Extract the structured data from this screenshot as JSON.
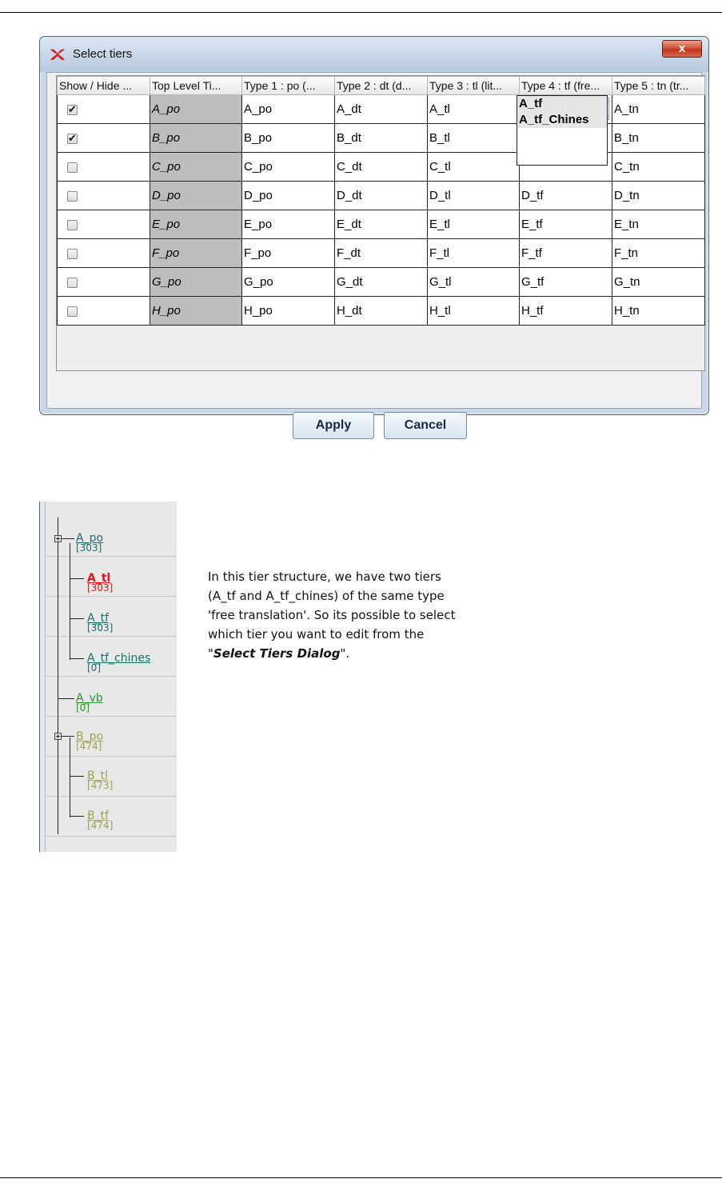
{
  "dialog": {
    "title": "Select tiers",
    "close_label": "x",
    "columns": [
      "Show / Hide ...",
      "Top Level Ti...",
      "Type 1 : po (...",
      "Type 2 : dt (d...",
      "Type 3 : tl (lit...",
      "Type 4 : tf (fre...",
      "Type 5 : tn (tr..."
    ],
    "rows": [
      {
        "checked": true,
        "top": "A_po",
        "t1": "A_po",
        "t2": "A_dt",
        "t3": "A_tl",
        "t4": "",
        "t5": "A_tn"
      },
      {
        "checked": true,
        "top": "B_po",
        "t1": "B_po",
        "t2": "B_dt",
        "t3": "B_tl",
        "t4": "",
        "t5": "B_tn"
      },
      {
        "checked": false,
        "top": "C_po",
        "t1": "C_po",
        "t2": "C_dt",
        "t3": "C_tl",
        "t4": "",
        "t5": "C_tn"
      },
      {
        "checked": false,
        "top": "D_po",
        "t1": "D_po",
        "t2": "D_dt",
        "t3": "D_tl",
        "t4": "D_tf",
        "t5": "D_tn"
      },
      {
        "checked": false,
        "top": "E_po",
        "t1": "E_po",
        "t2": "E_dt",
        "t3": "E_tl",
        "t4": "E_tf",
        "t5": "E_tn"
      },
      {
        "checked": false,
        "top": "F_po",
        "t1": "F_po",
        "t2": "F_dt",
        "t3": "F_tl",
        "t4": "F_tf",
        "t5": "F_tn"
      },
      {
        "checked": false,
        "top": "G_po",
        "t1": "G_po",
        "t2": "G_dt",
        "t3": "G_tl",
        "t4": "G_tf",
        "t5": "G_tn"
      },
      {
        "checked": false,
        "top": "H_po",
        "t1": "H_po",
        "t2": "H_dt",
        "t3": "H_tl",
        "t4": "H_tf",
        "t5": "H_tn"
      }
    ],
    "dropdown_options": [
      "A_tf",
      "A_tf_Chines"
    ],
    "apply_label": "Apply",
    "cancel_label": "Cancel"
  },
  "tree": {
    "nodes": [
      {
        "name": "A_po",
        "count": "[303]",
        "color": "#1e6b6b"
      },
      {
        "name": "A_tl",
        "count": "[303]",
        "color": "#e01515"
      },
      {
        "name": "A_tf",
        "count": "[303]",
        "color": "#1e6b6b"
      },
      {
        "name": "A_tf_chines",
        "count": "[0]",
        "color": "#1e6b6b"
      },
      {
        "name": "A_vb",
        "count": "[0]",
        "color": "#1f9a1f"
      },
      {
        "name": "B_po",
        "count": "[474]",
        "color": "#a0a050"
      },
      {
        "name": "B_tl",
        "count": "[473]",
        "color": "#a0a050"
      },
      {
        "name": "B_tf",
        "count": "[474]",
        "color": "#a0a050"
      }
    ]
  },
  "explanation": {
    "text_1": "In this tier structure, we have two tiers (A_tf and A_tf_chines) of the same type 'free translation'. So its possible to select which tier you want to edit from the \"",
    "emphasis": "Select Tiers Dialog",
    "text_2": "\"."
  }
}
